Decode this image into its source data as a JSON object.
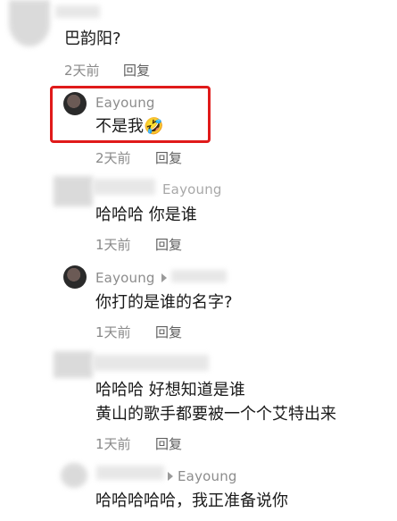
{
  "comment_top": {
    "text": "巴韵阳?",
    "time": "2天前",
    "reply_label": "回复"
  },
  "replies": [
    {
      "author": "Eayoung",
      "text": "不是我",
      "emoji": "🤣",
      "time": "2天前",
      "reply_label": "回复"
    },
    {
      "author": "Eayoung",
      "text": "哈哈哈 你是谁",
      "time": "1天前",
      "reply_label": "回复"
    },
    {
      "author": "Eayoung",
      "text": "你打的是谁的名字?",
      "time": "1天前",
      "reply_label": "回复"
    },
    {
      "text_line1": "哈哈哈 好想知道是谁",
      "text_line2": "黄山的歌手都要被一个个艾特出来",
      "time": "1天前",
      "reply_label": "回复"
    },
    {
      "author": "Eayoung",
      "text": "哈哈哈哈哈，我正准备说你"
    }
  ],
  "colors": {
    "highlight": "#e01a1a"
  }
}
